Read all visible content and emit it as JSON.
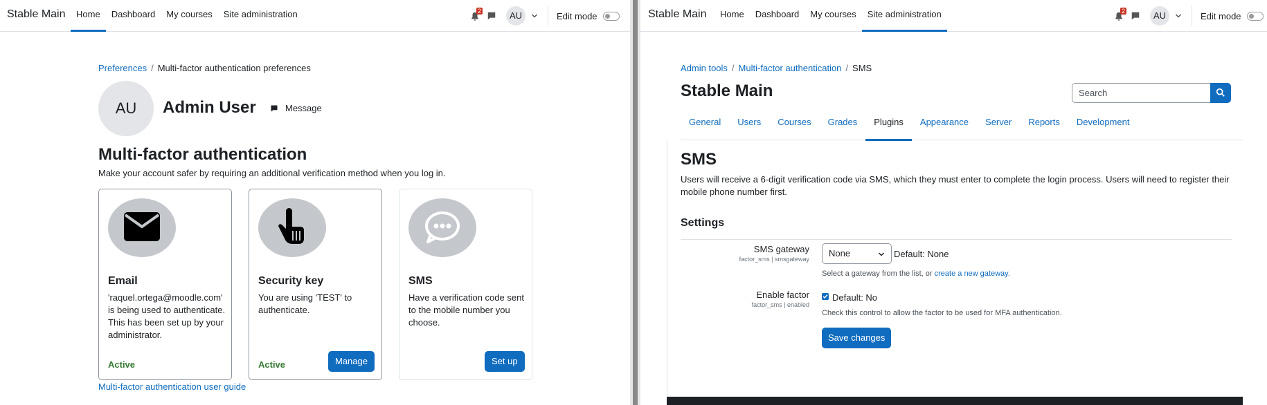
{
  "left": {
    "navbar": {
      "brand": "Stable Main",
      "links": [
        "Home",
        "Dashboard",
        "My courses",
        "Site administration"
      ],
      "active_link": "Home",
      "notification_count": "2",
      "avatar": "AU",
      "edit_mode_label": "Edit mode"
    },
    "breadcrumb": {
      "items": [
        "Preferences",
        "Multi-factor authentication preferences"
      ]
    },
    "user": {
      "initials": "AU",
      "name": "Admin User",
      "message_label": "Message"
    },
    "mfa": {
      "heading": "Multi-factor authentication",
      "description": "Make your account safer by requiring an additional verification method when you log in.",
      "factors": [
        {
          "icon": "envelope-icon",
          "title": "Email",
          "text": "'raquel.ortega@moodle.com' is being used to authenticate. This has been set up by your administrator.",
          "status": "Active",
          "button": ""
        },
        {
          "icon": "pointer-hand-icon",
          "title": "Security key",
          "text": "You are using 'TEST' to authenticate.",
          "status": "Active",
          "button": "Manage"
        },
        {
          "icon": "chat-bubble-icon",
          "title": "SMS",
          "text": "Have a verification code sent to the mobile number you choose.",
          "status": "",
          "button": "Set up"
        }
      ],
      "guide_link": "Multi-factor authentication user guide"
    }
  },
  "right": {
    "navbar": {
      "brand": "Stable Main",
      "links": [
        "Home",
        "Dashboard",
        "My courses",
        "Site administration"
      ],
      "active_link": "Site administration",
      "notification_count": "2",
      "avatar": "AU",
      "edit_mode_label": "Edit mode"
    },
    "breadcrumb": {
      "items": [
        "Admin tools",
        "Multi-factor authentication",
        "SMS"
      ]
    },
    "site_heading": "Stable Main",
    "search": {
      "placeholder": "Search"
    },
    "tabs": [
      "General",
      "Users",
      "Courses",
      "Grades",
      "Plugins",
      "Appearance",
      "Server",
      "Reports",
      "Development"
    ],
    "active_tab": "Plugins",
    "sms": {
      "heading": "SMS",
      "description": "Users will receive a 6-digit verification code via SMS, which they must enter to complete the login process. Users will need to register their mobile phone number first.",
      "settings_heading": "Settings",
      "gateway": {
        "label": "SMS gateway",
        "key": "factor_sms | smsgateway",
        "value": "None",
        "default": "Default: None",
        "help_prefix": "Select a gateway from the list, or",
        "help_link": "create a new gateway",
        "help_suffix": "."
      },
      "enable": {
        "label": "Enable factor",
        "key": "factor_sms | enabled",
        "checked": true,
        "default": "Default: No",
        "help": "Check this control to allow the factor to be used for MFA authentication."
      },
      "save_label": "Save changes"
    }
  },
  "colors": {
    "accent": "#0f6cbf",
    "active_status": "#357a32",
    "badge": "#ca3120",
    "icon_circle": "#c4c8cc"
  }
}
